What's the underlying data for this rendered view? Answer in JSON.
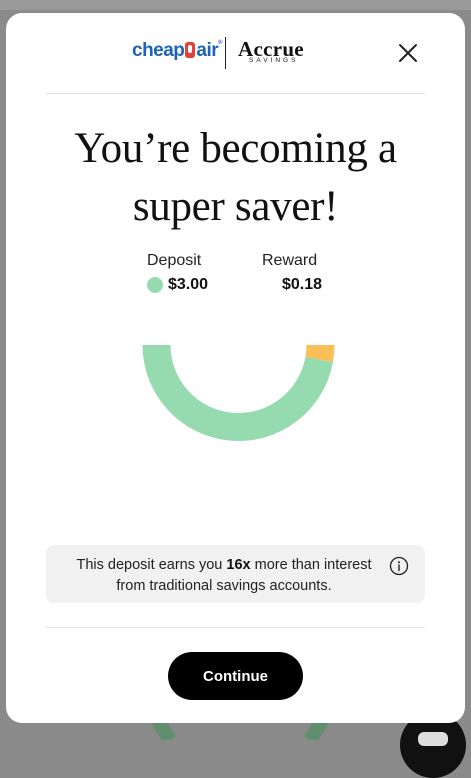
{
  "brand": {
    "partner_logo_text": "cheap",
    "partner_logo_text_2": "air",
    "partner_logo_reg": "®",
    "accrue_logo_text": "Accrue",
    "accrue_logo_sub": "SAVINGS"
  },
  "headline": {
    "line1": "You’re becoming a",
    "line2": "super saver!"
  },
  "legend": {
    "deposit_label": "Deposit",
    "deposit_value": "$3.00",
    "reward_label": "Reward",
    "reward_value": "$0.18"
  },
  "chart_data": {
    "type": "pie",
    "categories": [
      "Deposit",
      "Reward"
    ],
    "values": [
      3.0,
      0.18
    ],
    "colors": [
      "#96dbb0",
      "#f9c05a"
    ],
    "style": "half-donut"
  },
  "info": {
    "text_before": "This deposit earns you ",
    "multiplier": "16x",
    "text_after": " more than interest from traditional savings accounts."
  },
  "actions": {
    "continue_label": "Continue"
  },
  "icons": {
    "close": "close-icon",
    "info": "info-icon"
  },
  "colors": {
    "deposit": "#96dbb0",
    "reward": "#f9c05a",
    "button": "#000000",
    "info_bg": "#f1f1f1"
  }
}
